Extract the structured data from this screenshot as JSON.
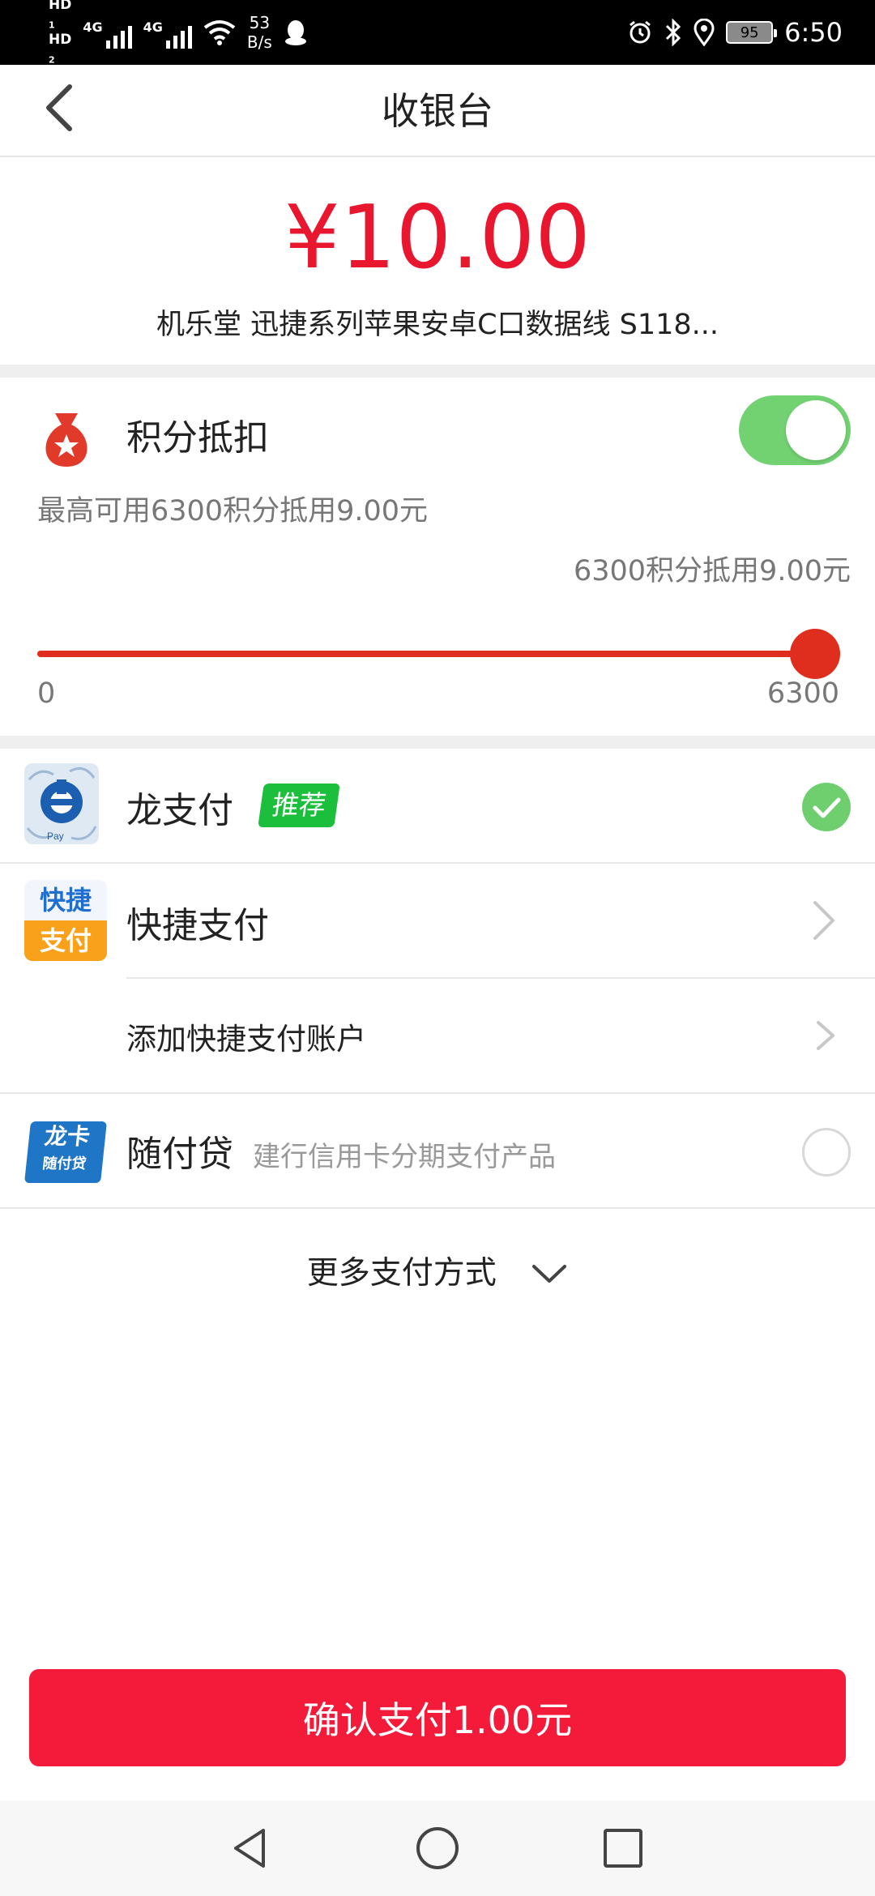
{
  "status_bar": {
    "hd1": "HD",
    "hd1_sub": "1",
    "hd2": "HD",
    "hd2_sub": "2",
    "net1": "4G",
    "net2": "4G",
    "speed_value": "53",
    "speed_unit": "B/s",
    "battery": "95",
    "time": "6:50"
  },
  "header": {
    "title": "收银台"
  },
  "order": {
    "amount": "¥10.00",
    "product": "机乐堂 迅捷系列苹果安卓C口数据线 S118..."
  },
  "points": {
    "title": "积分抵扣",
    "enabled": true,
    "max_desc": "最高可用6300积分抵用9.00元",
    "current_desc": "6300积分抵用9.00元",
    "slider_min": "0",
    "slider_max": "6300",
    "slider_value": 6300,
    "slider_max_value": 6300
  },
  "payment_methods": {
    "longpay": {
      "label": "龙支付",
      "badge": "推荐",
      "selected": true
    },
    "quickpay": {
      "label": "快捷支付",
      "icon_text_top": "快捷",
      "icon_text_bottom": "支付",
      "add_account": "添加快捷支付账户"
    },
    "suifudai": {
      "label": "随付贷",
      "desc": "建行信用卡分期支付产品",
      "icon_text_top": "龙卡",
      "icon_text_bottom": "随付贷",
      "selected": false
    },
    "more": "更多支付方式"
  },
  "confirm_button": "确认支付1.00元",
  "colors": {
    "accent_red": "#f41a39",
    "amount_red": "#e8162e",
    "toggle_green": "#72d272",
    "badge_green": "#1bbf3c"
  },
  "icons": [
    "back-arrow-icon",
    "money-bag-icon",
    "longpay-logo-icon",
    "quickpay-logo-icon",
    "suifudai-logo-icon",
    "chevron-right-icon",
    "check-icon",
    "chevron-down-icon",
    "nav-back-icon",
    "nav-home-icon",
    "nav-recent-icon"
  ]
}
